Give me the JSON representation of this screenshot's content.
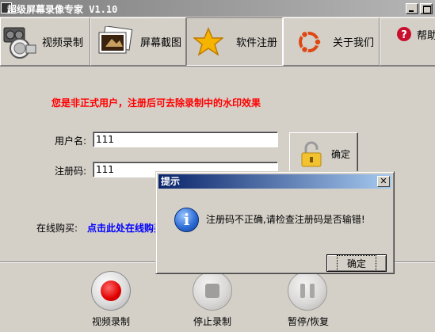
{
  "window": {
    "title": "超级屏幕录像专家  V1.10"
  },
  "toolbar": {
    "tabs": [
      {
        "label": "视频录制",
        "icon": "video-record-icon"
      },
      {
        "label": "屏幕截图",
        "icon": "screenshot-icon"
      },
      {
        "label": "软件注册",
        "icon": "star-icon"
      },
      {
        "label": "关于我们",
        "icon": "ubuntu-logo-icon"
      },
      {
        "label": "帮助",
        "icon": "help-icon"
      }
    ],
    "active_tab": "软件注册"
  },
  "register": {
    "notice": "您是非正式用户，注册后可去除录制中的水印效果",
    "username_label": "用户名:",
    "username_value": "111",
    "code_label": "注册码:",
    "code_value": "111",
    "confirm_label": "确定",
    "buy_label": "在线购买:",
    "buy_link": "点击此处在线购买"
  },
  "controls": {
    "record_label": "视频录制",
    "stop_label": "停止录制",
    "pause_label": "暂停/恢复"
  },
  "dialog": {
    "title": "提示",
    "message": "注册码不正确,请检查注册码是否输错!",
    "ok_label": "确定",
    "close_glyph": "✕"
  },
  "colors": {
    "notice": "#ff0000",
    "link": "#0000ff",
    "dialog_title_start": "#0a246a",
    "record": "#e00000"
  }
}
